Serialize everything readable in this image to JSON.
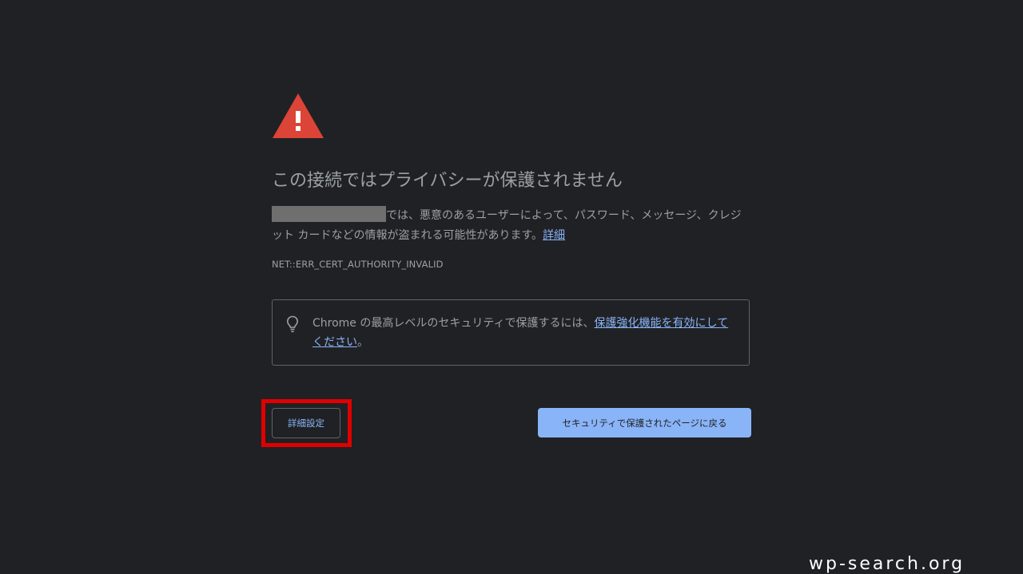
{
  "heading": "この接続ではプライバシーが保護されません",
  "description": {
    "text": "では、悪意のあるユーザーによって、パスワード、メッセージ、クレジット カードなどの情報が盗まれる可能性があります。",
    "link_label": "詳細"
  },
  "error_code": "NET::ERR_CERT_AUTHORITY_INVALID",
  "tip": {
    "icon": "lightbulb-icon",
    "text": "Chrome の最高レベルのセキュリティで保護するには、",
    "link_label": "保護強化機能を有効にしてください",
    "suffix": "。"
  },
  "buttons": {
    "advanced_label": "詳細設定",
    "back_label": "セキュリティで保護されたページに戻る"
  },
  "watermark": "wp-search.org",
  "colors": {
    "background": "#202124",
    "warning_red": "#db4437",
    "link": "#8ab4f8",
    "primary_button": "#8ab4f8",
    "highlight_frame": "#e00000"
  }
}
